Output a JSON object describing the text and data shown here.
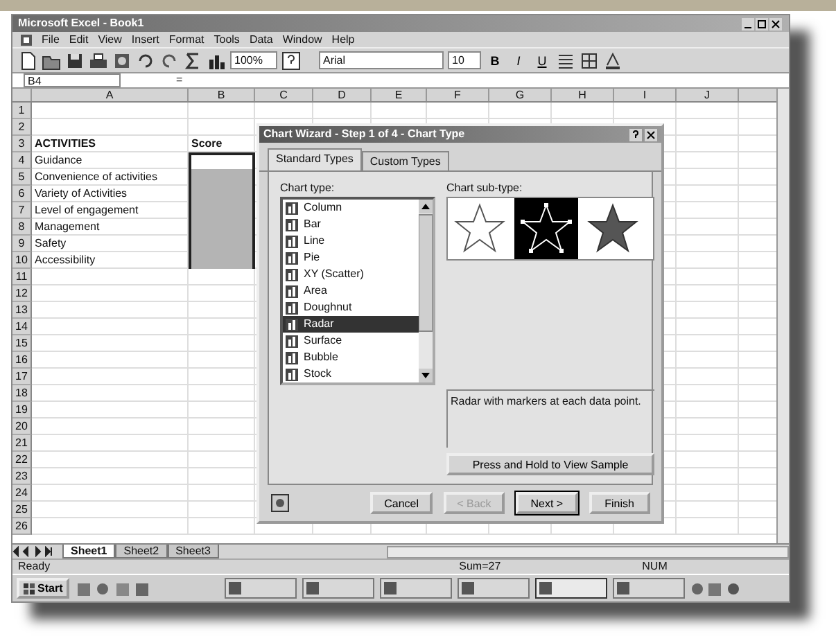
{
  "window": {
    "title": "Microsoft Excel - Book1"
  },
  "menu": [
    "File",
    "Edit",
    "View",
    "Insert",
    "Format",
    "Tools",
    "Data",
    "Window",
    "Help"
  ],
  "toolbar": {
    "zoom": "100%",
    "font": "Arial",
    "font_size": "10",
    "format_buttons": [
      "B",
      "I",
      "U"
    ]
  },
  "formula_bar": {
    "name_box": "B4",
    "equals": "="
  },
  "columns": [
    "A",
    "B",
    "C",
    "D",
    "E",
    "F",
    "G",
    "H",
    "I",
    "J"
  ],
  "rows": [
    {
      "number": "1",
      "selected": false
    },
    {
      "number": "2",
      "selected": false
    },
    {
      "number": "3",
      "a": "ACTIVITIES",
      "b": "Score",
      "kind": "heading",
      "selected": false
    },
    {
      "number": "4",
      "a": "Guidance",
      "selected": true
    },
    {
      "number": "5",
      "a": "Convenience of activities",
      "selected": true
    },
    {
      "number": "6",
      "a": "Variety of Activities",
      "selected": true
    },
    {
      "number": "7",
      "a": "Level of engagement",
      "selected": true
    },
    {
      "number": "8",
      "a": "Management",
      "selected": true
    },
    {
      "number": "9",
      "a": "Safety",
      "selected": true
    },
    {
      "number": "10",
      "a": "Accessibility",
      "selected": true
    },
    {
      "number": "11",
      "selected": false
    },
    {
      "number": "12",
      "selected": false
    },
    {
      "number": "13",
      "selected": false
    },
    {
      "number": "14",
      "selected": false
    },
    {
      "number": "15",
      "selected": false
    },
    {
      "number": "16",
      "selected": false
    },
    {
      "number": "17",
      "selected": false
    },
    {
      "number": "18",
      "selected": false
    },
    {
      "number": "19",
      "selected": false
    },
    {
      "number": "20",
      "selected": false
    },
    {
      "number": "21",
      "selected": false
    },
    {
      "number": "22",
      "selected": false
    },
    {
      "number": "23",
      "selected": false
    },
    {
      "number": "24",
      "selected": false
    },
    {
      "number": "25",
      "selected": false
    },
    {
      "number": "26",
      "selected": false
    }
  ],
  "dialog": {
    "title": "Chart Wizard - Step 1 of 4 - Chart Type",
    "tabs": [
      {
        "label": "Standard Types",
        "selected": true
      },
      {
        "label": "Custom Types",
        "selected": false
      }
    ],
    "chart_type_label": "Chart type:",
    "chart_types": [
      {
        "label": "Column",
        "selected": false
      },
      {
        "label": "Bar",
        "selected": false
      },
      {
        "label": "Line",
        "selected": false
      },
      {
        "label": "Pie",
        "selected": false
      },
      {
        "label": "XY (Scatter)",
        "selected": false
      },
      {
        "label": "Area",
        "selected": false
      },
      {
        "label": "Doughnut",
        "selected": false
      },
      {
        "label": "Radar",
        "selected": true
      },
      {
        "label": "Surface",
        "selected": false
      },
      {
        "label": "Bubble",
        "selected": false
      },
      {
        "label": "Stock",
        "selected": false
      }
    ],
    "subtype_label": "Chart sub-type:",
    "subtypes": [
      {
        "kind": "outline",
        "selected": false
      },
      {
        "kind": "markers",
        "selected": true
      },
      {
        "kind": "filled",
        "selected": false
      }
    ],
    "description": "Radar with markers at each data point.",
    "sample_button": "Press and Hold to View Sample",
    "buttons": [
      {
        "label": "Cancel",
        "disabled": false,
        "default": false
      },
      {
        "label": "< Back",
        "disabled": true,
        "default": false
      },
      {
        "label": "Next >",
        "disabled": false,
        "default": true
      },
      {
        "label": "Finish",
        "disabled": false,
        "default": false
      }
    ]
  },
  "sheet_tabs": [
    {
      "label": "Sheet1",
      "selected": true
    },
    {
      "label": "Sheet2",
      "selected": false
    },
    {
      "label": "Sheet3",
      "selected": false
    }
  ],
  "status_bar": {
    "left": "Ready",
    "sum": "Sum=27",
    "mode": "NUM"
  },
  "taskbar": {
    "start": "Start",
    "tasks": [
      {
        "selected": false
      },
      {
        "selected": false
      },
      {
        "selected": false
      },
      {
        "selected": false
      },
      {
        "selected": true
      },
      {
        "selected": false
      }
    ]
  }
}
